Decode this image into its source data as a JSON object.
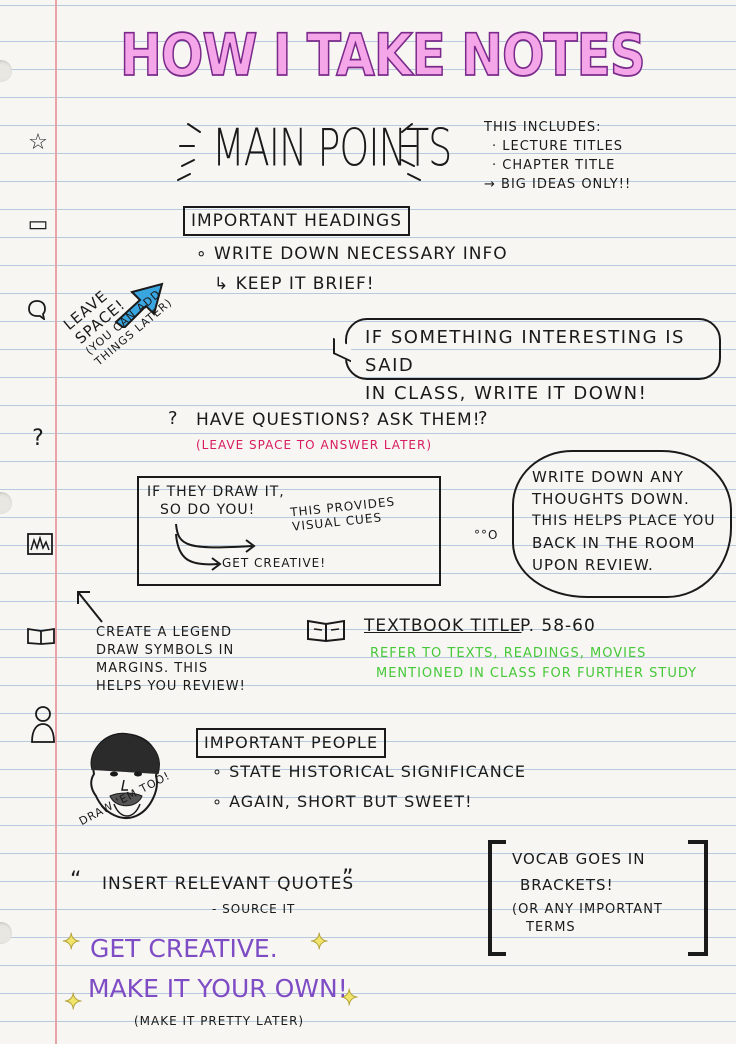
{
  "title": "How I Take Notes",
  "main_points": {
    "heading": "Main Points",
    "includes_label": "This includes:",
    "includes_items": [
      "· Lecture titles",
      "· Chapter title",
      "→ Big ideas only!!"
    ]
  },
  "headings": {
    "label": "Important Headings",
    "bullet": "∘ Write down necessary info",
    "sub": "↳ Keep it brief!"
  },
  "leave_space": {
    "line1": "Leave",
    "line2": "Space!",
    "note1": "(You can add",
    "note2": "things later)"
  },
  "speech": {
    "line1": "If something interesting is said",
    "line2": "in class, write it down!"
  },
  "questions": {
    "main": "Have questions? Ask them!",
    "sub": "(Leave space to answer later)"
  },
  "draw": {
    "line1": "If they draw it,",
    "line2": "so do you!",
    "provides1": "This provides",
    "provides2": "visual cues",
    "creative": "Get creative!"
  },
  "cloud": {
    "lines": [
      "Write down any",
      "thoughts down.",
      "This helps place you",
      "back in the room",
      "upon review."
    ]
  },
  "legend": {
    "lines": [
      "Create a legend",
      "draw symbols in",
      "margins. This",
      "helps you review!"
    ]
  },
  "textbook": {
    "title": "Textbook title",
    "pages": "p. 58-60",
    "note1": "Refer to texts, readings, movies",
    "note2": "mentioned in class for further study"
  },
  "people": {
    "label": "Important People",
    "bullet1": "∘ State historical significance",
    "bullet2": "∘ Again, short but sweet!",
    "draw_em": "Draw 'em too!"
  },
  "quotes": {
    "main": "Insert relevant quotes",
    "source": "- source it"
  },
  "vocab": {
    "line1": "Vocab goes in",
    "line2": "brackets!",
    "line3": "(or any important",
    "line4": "terms"
  },
  "creative": {
    "line1": "Get creative.",
    "line2": "Make it your own!",
    "sub": "(Make it pretty later)"
  },
  "colors": {
    "title_fill": "#f4a6e8",
    "pink": "#d81b60",
    "green": "#46c83a",
    "purple": "#7e4cc4",
    "arrow_blue": "#3aa6e0",
    "margin_red": "#e7a3a8",
    "rule_blue": "#b7c9dd"
  },
  "margin_icons": [
    "star-icon",
    "rectangle-icon",
    "speech-bubble-icon",
    "question-mark-icon",
    "chart-icon",
    "book-icon",
    "person-icon"
  ]
}
